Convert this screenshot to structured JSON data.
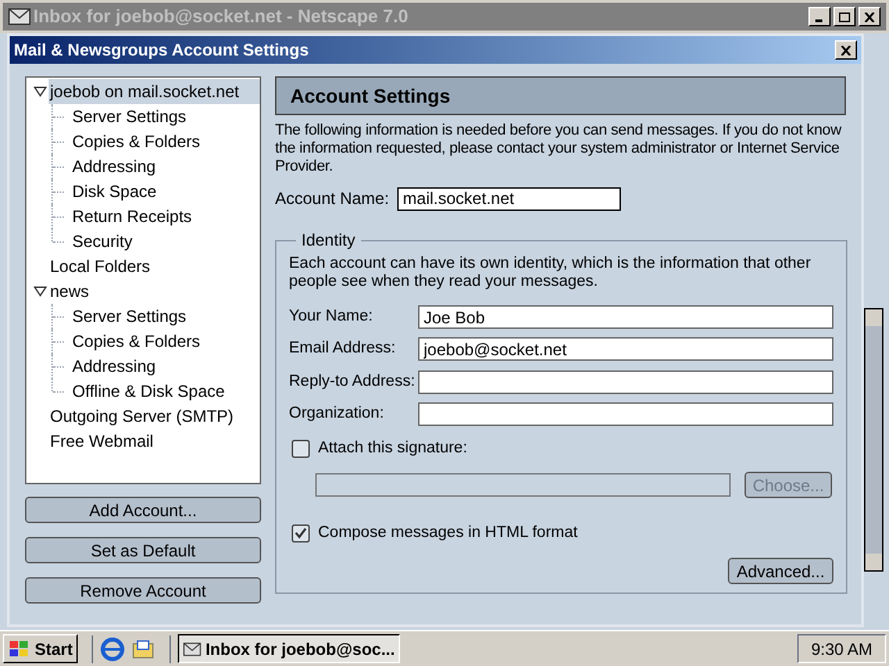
{
  "main_window": {
    "title": "Inbox for joebob@socket.net - Netscape 7.0"
  },
  "dialog": {
    "title": "Mail & Newsgroups Account Settings"
  },
  "tree": [
    {
      "label": "joebob on mail.socket.net",
      "selected": true,
      "expanded": true,
      "children": [
        {
          "label": "Server Settings",
          "selected": false
        },
        {
          "label": "Copies & Folders",
          "selected": false
        },
        {
          "label": "Addressing",
          "selected": false
        },
        {
          "label": "Disk Space",
          "selected": false
        },
        {
          "label": "Return Receipts",
          "selected": false
        },
        {
          "label": "Security",
          "selected": false
        }
      ]
    },
    {
      "label": "Local Folders",
      "selected": false
    },
    {
      "label": "news",
      "selected": false,
      "expanded": true,
      "children": [
        {
          "label": "Server Settings",
          "selected": false
        },
        {
          "label": "Copies & Folders",
          "selected": false
        },
        {
          "label": "Addressing",
          "selected": false
        },
        {
          "label": "Offline & Disk Space",
          "selected": false
        }
      ]
    },
    {
      "label": "Outgoing Server (SMTP)",
      "selected": false
    },
    {
      "label": "Free Webmail",
      "selected": false
    }
  ],
  "account_buttons": [
    "Add Account...",
    "Set as Default",
    "Remove Account"
  ],
  "panel": {
    "heading": "Account Settings",
    "intro": "The following information is needed before you can send messages. If you do not know the information requested, please contact your system administrator or Internet Service Provider.",
    "account_name": {
      "label": "Account Name:",
      "value": "mail.socket.net"
    }
  },
  "identity": {
    "legend": "Identity",
    "description": "Each account can have its own identity, which is the information that other people see when they read your messages.",
    "fields": [
      {
        "label": "Your Name:",
        "value": "Joe Bob"
      },
      {
        "label": "Email Address:",
        "value": "joebob@socket.net"
      },
      {
        "label": "Reply-to Address:"
      },
      {
        "label": "Organization:"
      }
    ],
    "signature": {
      "label": "Attach this signature:",
      "checked": false,
      "choose_button": "Choose...",
      "disabled": true
    },
    "html": {
      "label": "Compose messages in HTML format",
      "checked": true
    },
    "advanced_button": "Advanced..."
  },
  "taskbar": {
    "start": "Start",
    "task": "Inbox for joebob@soc...",
    "clock": "9:30 AM"
  }
}
